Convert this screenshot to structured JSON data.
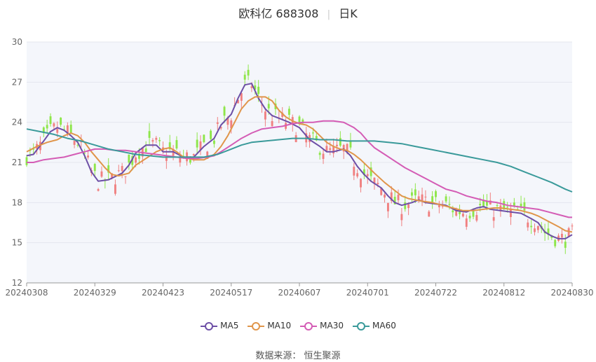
{
  "header": {
    "stock": "欧科亿 688308",
    "period": "日K"
  },
  "source_text": "数据来源： 恒生聚源",
  "colors": {
    "up": "#f08080",
    "down": "#8ee64a",
    "MA5": "#6d4fa6",
    "MA10": "#e0954a",
    "MA30": "#d45cb5",
    "MA60": "#3a9a9a"
  },
  "chart_data": {
    "type": "line",
    "ylim": [
      12,
      30
    ],
    "yticks": [
      12,
      15,
      18,
      21,
      24,
      27,
      30
    ],
    "x_tick_labels": [
      "20240308",
      "20240329",
      "20240423",
      "20240517",
      "20240607",
      "20240701",
      "20240722",
      "20240812",
      "20240830"
    ],
    "x_tick_index": [
      0,
      20,
      40,
      60,
      80,
      100,
      120,
      140,
      160
    ],
    "n_days": 161,
    "grid": true,
    "legend_position": "bottom",
    "series": [
      {
        "name": "MA5",
        "knots": [
          [
            0,
            21.5
          ],
          [
            2,
            21.6
          ],
          [
            5,
            22.6
          ],
          [
            7,
            23.3
          ],
          [
            9,
            23.6
          ],
          [
            11,
            23.4
          ],
          [
            13,
            23
          ],
          [
            15,
            22.5
          ],
          [
            17,
            21.5
          ],
          [
            19,
            20.3
          ],
          [
            21,
            19.6
          ],
          [
            24,
            19.7
          ],
          [
            28,
            20.2
          ],
          [
            30,
            20.8
          ],
          [
            32,
            21.7
          ],
          [
            35,
            22.3
          ],
          [
            38,
            22.3
          ],
          [
            40,
            21.8
          ],
          [
            43,
            21.8
          ],
          [
            46,
            21.4
          ],
          [
            49,
            21.4
          ],
          [
            52,
            22.2
          ],
          [
            55,
            22.8
          ],
          [
            57,
            23.8
          ],
          [
            60,
            24.6
          ],
          [
            62,
            25.8
          ],
          [
            64,
            26.8
          ],
          [
            66,
            26.9
          ],
          [
            68,
            25.8
          ],
          [
            70,
            25
          ],
          [
            72,
            24.5
          ],
          [
            75,
            24.2
          ],
          [
            77,
            24
          ],
          [
            80,
            23.6
          ],
          [
            83,
            22.7
          ],
          [
            86,
            22.2
          ],
          [
            88,
            21.8
          ],
          [
            90,
            21.8
          ],
          [
            93,
            22
          ],
          [
            95,
            21.5
          ],
          [
            97,
            20.7
          ],
          [
            99,
            20.1
          ],
          [
            101,
            19.6
          ],
          [
            104,
            19.1
          ],
          [
            106,
            18.5
          ],
          [
            108,
            18
          ],
          [
            110,
            17.8
          ],
          [
            113,
            18
          ],
          [
            115,
            18.2
          ],
          [
            117,
            18
          ],
          [
            120,
            17.9
          ],
          [
            123,
            17.8
          ],
          [
            126,
            17.4
          ],
          [
            129,
            17.3
          ],
          [
            132,
            17.6
          ],
          [
            134,
            17.7
          ],
          [
            136,
            17.5
          ],
          [
            139,
            17.4
          ],
          [
            142,
            17.3
          ],
          [
            145,
            17.2
          ],
          [
            148,
            16.8
          ],
          [
            150,
            16.5
          ],
          [
            152,
            15.8
          ],
          [
            154,
            15.5
          ],
          [
            156,
            15.3
          ],
          [
            158,
            15.3
          ],
          [
            160,
            15.6
          ]
        ]
      },
      {
        "name": "MA10",
        "knots": [
          [
            0,
            21.8
          ],
          [
            3,
            22.2
          ],
          [
            6,
            22.5
          ],
          [
            9,
            22.7
          ],
          [
            11,
            23
          ],
          [
            13,
            23.2
          ],
          [
            15,
            23
          ],
          [
            17,
            22.5
          ],
          [
            19,
            21.8
          ],
          [
            21,
            21.2
          ],
          [
            23,
            20.6
          ],
          [
            25,
            20.1
          ],
          [
            27,
            20
          ],
          [
            30,
            20.2
          ],
          [
            32,
            20.8
          ],
          [
            35,
            21.3
          ],
          [
            38,
            21.8
          ],
          [
            40,
            22
          ],
          [
            42,
            22.1
          ],
          [
            44,
            21.8
          ],
          [
            46,
            21.4
          ],
          [
            49,
            21.2
          ],
          [
            52,
            21.2
          ],
          [
            55,
            21.6
          ],
          [
            57,
            22.2
          ],
          [
            59,
            23
          ],
          [
            61,
            24
          ],
          [
            63,
            25
          ],
          [
            65,
            25.6
          ],
          [
            67,
            25.9
          ],
          [
            70,
            25.9
          ],
          [
            72,
            25.6
          ],
          [
            74,
            24.9
          ],
          [
            76,
            24.4
          ],
          [
            78,
            24.1
          ],
          [
            80,
            23.9
          ],
          [
            82,
            23.8
          ],
          [
            84,
            23.5
          ],
          [
            86,
            23
          ],
          [
            88,
            22.5
          ],
          [
            90,
            22.2
          ],
          [
            92,
            22
          ],
          [
            94,
            21.9
          ],
          [
            96,
            21.6
          ],
          [
            98,
            21.2
          ],
          [
            100,
            20.7
          ],
          [
            102,
            20.2
          ],
          [
            105,
            19.5
          ],
          [
            108,
            18.9
          ],
          [
            110,
            18.5
          ],
          [
            112,
            18.3
          ],
          [
            114,
            18.2
          ],
          [
            116,
            18.1
          ],
          [
            119,
            18
          ],
          [
            122,
            17.8
          ],
          [
            125,
            17.6
          ],
          [
            128,
            17.4
          ],
          [
            131,
            17.4
          ],
          [
            134,
            17.5
          ],
          [
            137,
            17.6
          ],
          [
            139,
            17.6
          ],
          [
            142,
            17.5
          ],
          [
            145,
            17.4
          ],
          [
            148,
            17.2
          ],
          [
            150,
            17
          ],
          [
            153,
            16.6
          ],
          [
            156,
            16.2
          ],
          [
            158,
            15.9
          ],
          [
            160,
            15.8
          ]
        ]
      },
      {
        "name": "MA30",
        "knots": [
          [
            0,
            21
          ],
          [
            2,
            21
          ],
          [
            5,
            21.2
          ],
          [
            8,
            21.3
          ],
          [
            11,
            21.4
          ],
          [
            14,
            21.6
          ],
          [
            17,
            21.8
          ],
          [
            20,
            22
          ],
          [
            23,
            22
          ],
          [
            26,
            21.9
          ],
          [
            29,
            21.9
          ],
          [
            32,
            21.8
          ],
          [
            35,
            21.7
          ],
          [
            38,
            21.6
          ],
          [
            41,
            21.5
          ],
          [
            44,
            21.4
          ],
          [
            47,
            21.3
          ],
          [
            50,
            21.3
          ],
          [
            53,
            21.4
          ],
          [
            55,
            21.5
          ],
          [
            57,
            21.8
          ],
          [
            60,
            22.3
          ],
          [
            63,
            22.8
          ],
          [
            66,
            23.2
          ],
          [
            69,
            23.5
          ],
          [
            72,
            23.6
          ],
          [
            75,
            23.7
          ],
          [
            78,
            23.9
          ],
          [
            81,
            24
          ],
          [
            84,
            24
          ],
          [
            87,
            24.1
          ],
          [
            90,
            24.1
          ],
          [
            93,
            24
          ],
          [
            96,
            23.6
          ],
          [
            98,
            23.2
          ],
          [
            100,
            22.6
          ],
          [
            102,
            22.1
          ],
          [
            105,
            21.6
          ],
          [
            108,
            21.1
          ],
          [
            111,
            20.6
          ],
          [
            114,
            20.2
          ],
          [
            117,
            19.8
          ],
          [
            120,
            19.4
          ],
          [
            123,
            19
          ],
          [
            126,
            18.8
          ],
          [
            129,
            18.5
          ],
          [
            132,
            18.3
          ],
          [
            135,
            18.1
          ],
          [
            138,
            18
          ],
          [
            141,
            17.8
          ],
          [
            144,
            17.7
          ],
          [
            147,
            17.6
          ],
          [
            150,
            17.5
          ],
          [
            153,
            17.3
          ],
          [
            156,
            17.1
          ],
          [
            159,
            16.9
          ],
          [
            160,
            16.9
          ]
        ]
      },
      {
        "name": "MA60",
        "knots": [
          [
            0,
            23.5
          ],
          [
            4,
            23.3
          ],
          [
            8,
            23.1
          ],
          [
            12,
            22.8
          ],
          [
            16,
            22.6
          ],
          [
            20,
            22.3
          ],
          [
            24,
            22
          ],
          [
            28,
            21.8
          ],
          [
            32,
            21.6
          ],
          [
            36,
            21.5
          ],
          [
            40,
            21.4
          ],
          [
            44,
            21.4
          ],
          [
            48,
            21.4
          ],
          [
            52,
            21.4
          ],
          [
            56,
            21.6
          ],
          [
            60,
            22
          ],
          [
            63,
            22.3
          ],
          [
            66,
            22.5
          ],
          [
            70,
            22.6
          ],
          [
            74,
            22.7
          ],
          [
            78,
            22.8
          ],
          [
            82,
            22.8
          ],
          [
            86,
            22.7
          ],
          [
            90,
            22.7
          ],
          [
            94,
            22.6
          ],
          [
            98,
            22.6
          ],
          [
            102,
            22.6
          ],
          [
            106,
            22.5
          ],
          [
            110,
            22.4
          ],
          [
            114,
            22.2
          ],
          [
            118,
            22
          ],
          [
            122,
            21.8
          ],
          [
            126,
            21.6
          ],
          [
            130,
            21.4
          ],
          [
            134,
            21.2
          ],
          [
            138,
            21
          ],
          [
            142,
            20.7
          ],
          [
            146,
            20.3
          ],
          [
            150,
            19.9
          ],
          [
            154,
            19.5
          ],
          [
            158,
            19
          ],
          [
            160,
            18.8
          ]
        ]
      }
    ]
  }
}
